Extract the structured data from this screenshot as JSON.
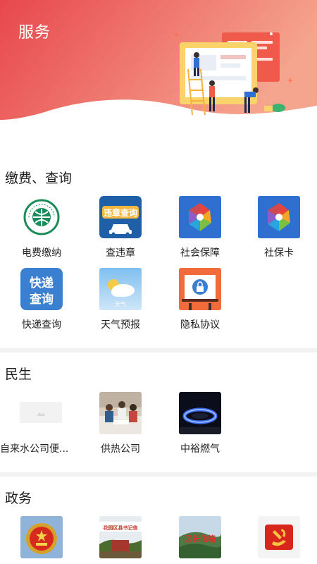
{
  "header": {
    "title": "服务"
  },
  "sections": [
    {
      "title": "缴费、查询",
      "items": [
        {
          "label": "电费缴纳",
          "icon": "state-grid-logo-icon"
        },
        {
          "label": "查违章",
          "icon": "violation-query-icon",
          "icon_text": "违章查询"
        },
        {
          "label": "社会保障",
          "icon": "social-security-icon"
        },
        {
          "label": "社保卡",
          "icon": "social-security-card-icon"
        },
        {
          "label": "快递查询",
          "icon": "express-query-icon",
          "icon_text_1": "快递",
          "icon_text_2": "查询"
        },
        {
          "label": "天气预报",
          "icon": "weather-icon",
          "icon_text": "天气"
        },
        {
          "label": "隐私协议",
          "icon": "privacy-lock-icon"
        }
      ]
    },
    {
      "title": "民生",
      "items": [
        {
          "label": "自来水公司便...",
          "icon": "image-placeholder-icon"
        },
        {
          "label": "供热公司",
          "icon": "heating-company-photo-icon"
        },
        {
          "label": "中裕燃气",
          "icon": "gas-flame-icon"
        }
      ]
    },
    {
      "title": "政务",
      "items": [
        {
          "label": "",
          "icon": "national-emblem-icon"
        },
        {
          "label": "",
          "icon": "discipline-inspection-photo-icon",
          "icon_text": "花园区县书记信"
        },
        {
          "label": "",
          "icon": "mayor-mailbox-photo-icon",
          "icon_text": "区长信箱"
        },
        {
          "label": "",
          "icon": "party-emblem-icon"
        }
      ]
    }
  ],
  "colors": {
    "header_gradient_start": "#e94a4f",
    "header_gradient_end": "#f39a85",
    "violation_blue": "#1f5fa8",
    "express_blue": "#3b7fd0",
    "weather_sky": "#a9d2f3",
    "privacy_orange": "#f26b3a"
  }
}
